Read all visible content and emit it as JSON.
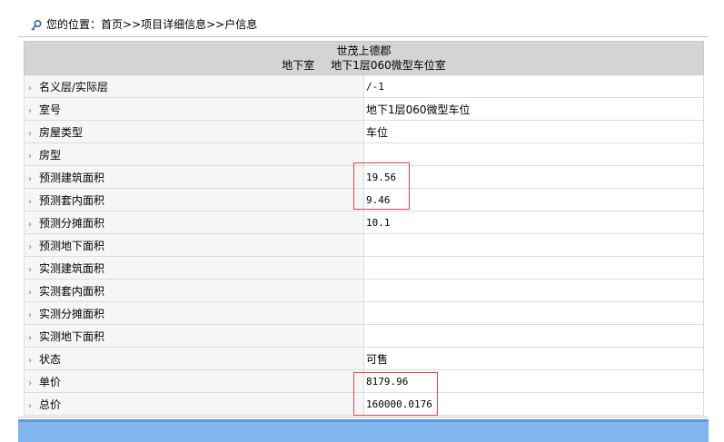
{
  "breadcrumb": {
    "icon": "key-icon",
    "prefix": "您的位置：",
    "path": "首页>>项目详细信息>>户信息"
  },
  "header": {
    "project": "世茂上德郡",
    "floor": "地下室",
    "unit": "地下1层060微型车位室"
  },
  "rows": [
    {
      "label": "名义层/实际层",
      "value": "/-1"
    },
    {
      "label": "室号",
      "value": "地下1层060微型车位"
    },
    {
      "label": "房屋类型",
      "value": "车位"
    },
    {
      "label": "房型",
      "value": ""
    },
    {
      "label": "预测建筑面积",
      "value": "19.56"
    },
    {
      "label": "预测套内面积",
      "value": "9.46"
    },
    {
      "label": "预测分摊面积",
      "value": "10.1"
    },
    {
      "label": "预测地下面积",
      "value": ""
    },
    {
      "label": "实测建筑面积",
      "value": ""
    },
    {
      "label": "实测套内面积",
      "value": ""
    },
    {
      "label": "实测分摊面积",
      "value": ""
    },
    {
      "label": "实测地下面积",
      "value": ""
    },
    {
      "label": "状态",
      "value": "可售"
    },
    {
      "label": "单价",
      "value": "8179.96"
    },
    {
      "label": "总价",
      "value": "160000.0176"
    }
  ],
  "colors": {
    "highlight_box": "#e04545",
    "header_bg": "#d4d4d4",
    "footer_bar": "#7fb6ee"
  }
}
